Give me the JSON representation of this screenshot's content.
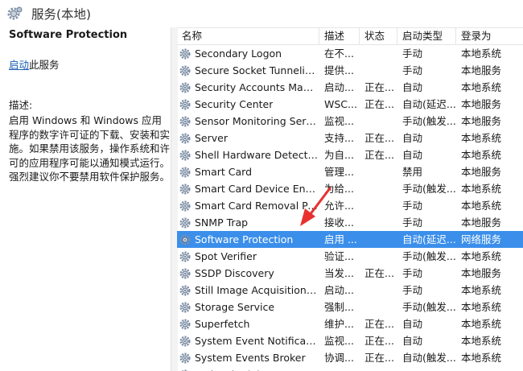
{
  "window": {
    "title": "服务(本地)"
  },
  "left": {
    "service_title": "Software Protection",
    "action_link": "启动",
    "action_suffix": "此服务",
    "desc_label": "描述:",
    "desc_text": "启用 Windows 和 Windows 应用程序的数字许可证的下载、安装和实施。如果禁用该服务，操作系统和许可的应用程序可能以通知模式运行。强烈建议你不要禁用软件保护服务。"
  },
  "columns": {
    "name": "名称",
    "desc": "描述",
    "status": "状态",
    "start": "启动类型",
    "logon": "登录为"
  },
  "services": [
    {
      "name": "Secondary Logon",
      "desc": "在不...",
      "status": "",
      "start": "手动",
      "logon": "本地系统"
    },
    {
      "name": "Secure Socket Tunneling ...",
      "desc": "提供...",
      "status": "",
      "start": "手动",
      "logon": "本地服务"
    },
    {
      "name": "Security Accounts Manag...",
      "desc": "启动...",
      "status": "正在...",
      "start": "自动",
      "logon": "本地系统"
    },
    {
      "name": "Security Center",
      "desc": "WSC...",
      "status": "正在...",
      "start": "自动(延迟...",
      "logon": "本地服务"
    },
    {
      "name": "Sensor Monitoring Service",
      "desc": "监视...",
      "status": "",
      "start": "手动(触发...",
      "logon": "本地服务"
    },
    {
      "name": "Server",
      "desc": "支持...",
      "status": "正在...",
      "start": "自动",
      "logon": "本地系统"
    },
    {
      "name": "Shell Hardware Detection",
      "desc": "为自...",
      "status": "正在...",
      "start": "自动",
      "logon": "本地系统"
    },
    {
      "name": "Smart Card",
      "desc": "管理...",
      "status": "",
      "start": "禁用",
      "logon": "本地服务"
    },
    {
      "name": "Smart Card Device Enum...",
      "desc": "为给...",
      "status": "",
      "start": "手动(触发...",
      "logon": "本地系统"
    },
    {
      "name": "Smart Card Removal Poli...",
      "desc": "允许...",
      "status": "",
      "start": "手动",
      "logon": "本地系统"
    },
    {
      "name": "SNMP Trap",
      "desc": "接收...",
      "status": "",
      "start": "手动",
      "logon": "本地服务"
    },
    {
      "name": "Software Protection",
      "desc": "启用 ...",
      "status": "",
      "start": "自动(延迟...",
      "logon": "网络服务"
    },
    {
      "name": "Spot Verifier",
      "desc": "验证...",
      "status": "",
      "start": "手动(触发...",
      "logon": "本地系统"
    },
    {
      "name": "SSDP Discovery",
      "desc": "当发...",
      "status": "正在...",
      "start": "手动",
      "logon": "本地服务"
    },
    {
      "name": "Still Image Acquisition Ev...",
      "desc": "启动...",
      "status": "",
      "start": "手动",
      "logon": "本地系统"
    },
    {
      "name": "Storage Service",
      "desc": "强制...",
      "status": "",
      "start": "手动(触发...",
      "logon": "本地系统"
    },
    {
      "name": "Superfetch",
      "desc": "维护...",
      "status": "正在...",
      "start": "自动",
      "logon": "本地系统"
    },
    {
      "name": "System Event Notification...",
      "desc": "监视...",
      "status": "正在...",
      "start": "自动",
      "logon": "本地系统"
    },
    {
      "name": "System Events Broker",
      "desc": "协调...",
      "status": "正在...",
      "start": "自动(触发...",
      "logon": "本地系统"
    },
    {
      "name": "Task Scheduler",
      "desc": "",
      "status": "",
      "start": "",
      "logon": ""
    }
  ],
  "selected_index": 11,
  "colors": {
    "selection": "#3b8fea",
    "arrow": "#e8312f",
    "link": "#1a5fb4"
  }
}
